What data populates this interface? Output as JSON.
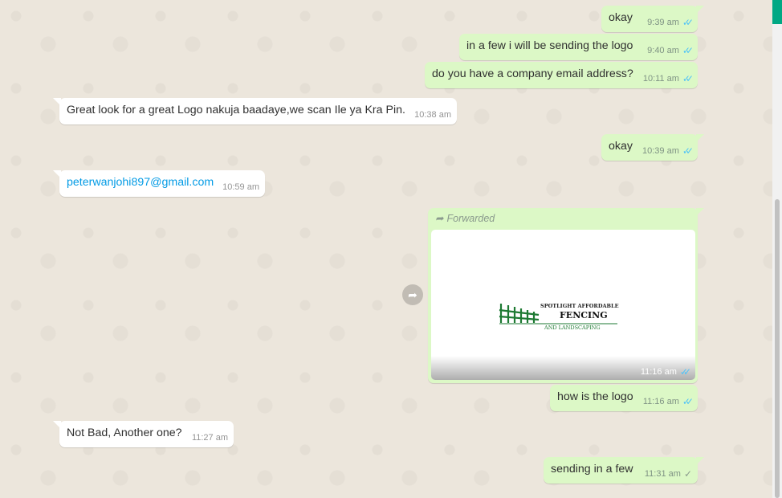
{
  "colors": {
    "outgoing_bubble": "#dcf8c6",
    "incoming_bubble": "#ffffff",
    "read_tick": "#4fc3f7",
    "link": "#039be5",
    "logo_green": "#1e7a33"
  },
  "messages": [
    {
      "dir": "out",
      "text": "okay",
      "time": "9:39 am",
      "status": "read"
    },
    {
      "dir": "out",
      "text": "in a few i will be sending the logo",
      "time": "9:40 am",
      "status": "read"
    },
    {
      "dir": "out",
      "text": "do you have a company email address?",
      "time": "10:11 am",
      "status": "read"
    },
    {
      "dir": "in",
      "text": "Great look for a great Logo nakuja baadaye,we scan Ile ya Kra Pin.",
      "time": "10:38 am"
    },
    {
      "dir": "out",
      "text": "okay",
      "time": "10:39 am",
      "status": "read"
    },
    {
      "dir": "in",
      "text": "peterwanjohi897@gmail.com",
      "time": "10:59 am",
      "is_link": true
    },
    {
      "dir": "out",
      "forwarded_label": "Forwarded",
      "image": {
        "logo_line1": "SPOTLIGHT AFFORDABLE",
        "logo_line2": "FENCING",
        "logo_line3": "AND LANDSCAPING"
      },
      "time": "11:16 am",
      "status": "read"
    },
    {
      "dir": "out",
      "text": "how is the logo",
      "time": "11:16 am",
      "status": "read"
    },
    {
      "dir": "in",
      "text": "Not Bad, Another one?",
      "time": "11:27 am"
    },
    {
      "dir": "out",
      "text": "sending in a few",
      "time": "11:31 am",
      "status": "sent"
    }
  ],
  "icons": {
    "read": "double-check-icon",
    "sent": "single-check-icon",
    "forward": "forward-arrow-icon"
  }
}
